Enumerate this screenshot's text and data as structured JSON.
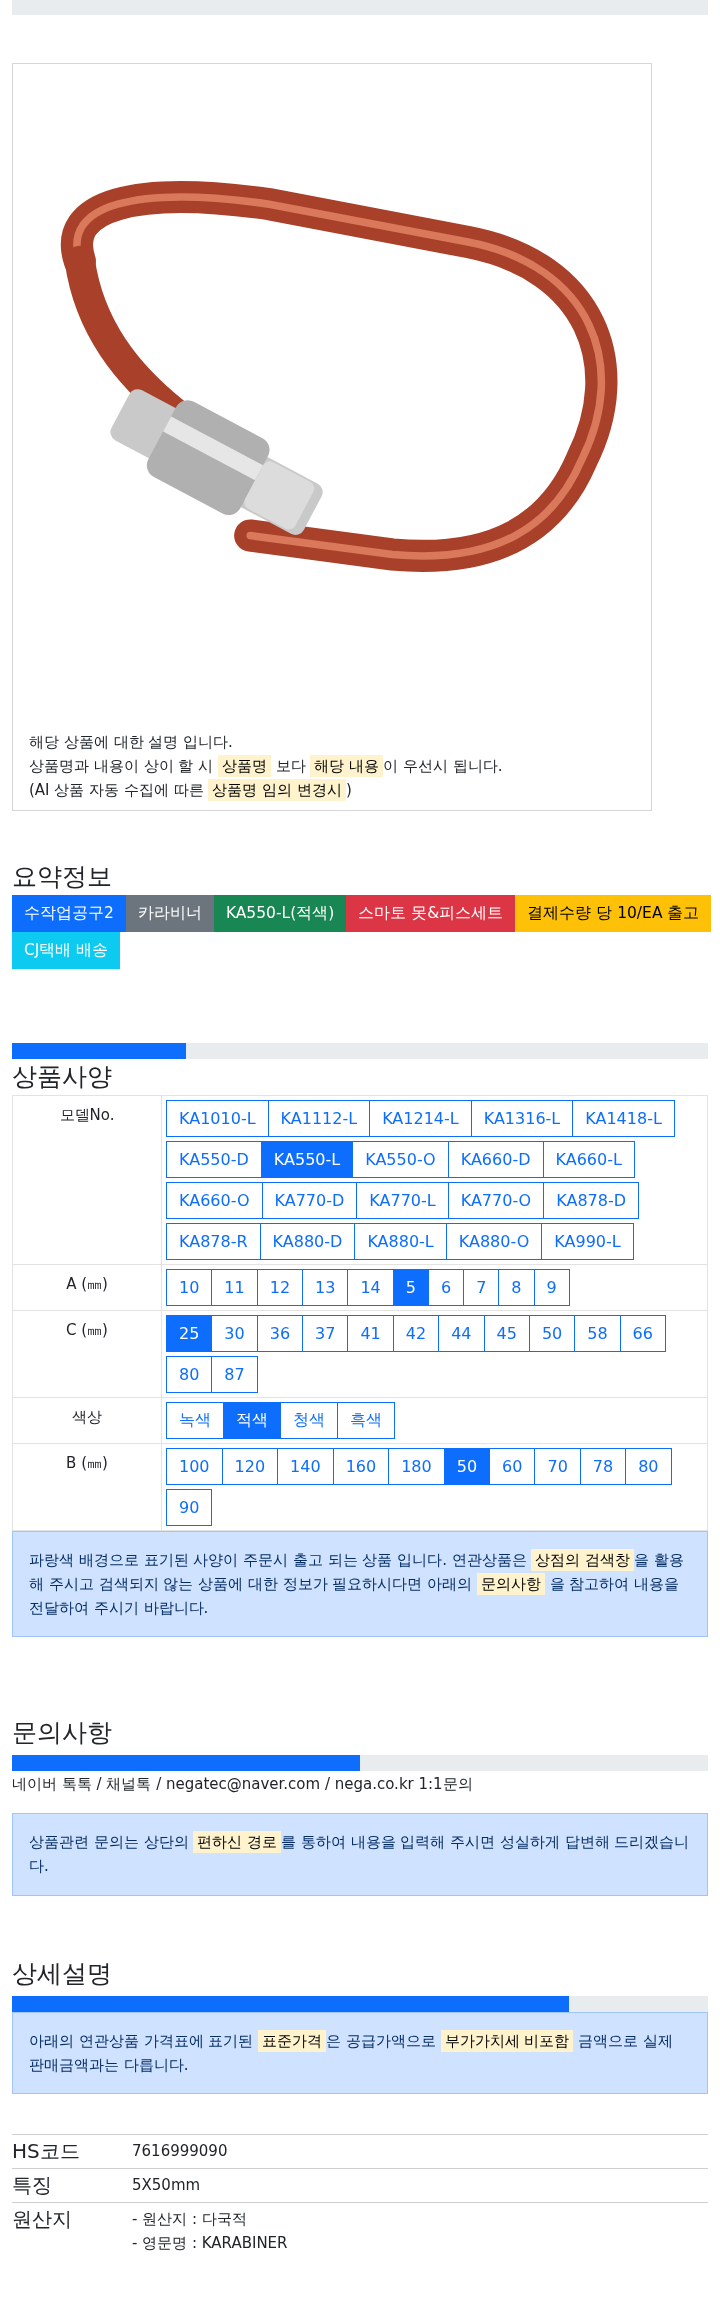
{
  "top_progress": {
    "level": 0
  },
  "description": {
    "lines": [
      [
        {
          "text": "해당 상품에 대한 설명 입니다.",
          "highlight": false
        }
      ],
      [
        {
          "text": "상품명과 내용이 상이 할 시 ",
          "highlight": false
        },
        {
          "text": "상품명",
          "highlight": true
        },
        {
          "text": " 보다 ",
          "highlight": false
        },
        {
          "text": "해당 내용",
          "highlight": true
        },
        {
          "text": "이 우선시 됩니다.",
          "highlight": false
        }
      ],
      [
        {
          "text": "(AI 상품 자동 수집에 따른 ",
          "highlight": false
        },
        {
          "text": "상품명 임의 변경시",
          "highlight": true
        },
        {
          "text": ")",
          "highlight": false
        }
      ]
    ]
  },
  "summary": {
    "title": "요약정보",
    "tags": [
      {
        "label": "수작업공구2",
        "color": "#0d6efd"
      },
      {
        "label": "카라비너",
        "color": "#6c757d"
      },
      {
        "label": "KA550-L(적색)",
        "color": "#198754"
      },
      {
        "label": "스마토 못&피스세트",
        "color": "#dc3545"
      },
      {
        "label": "결제수량 당 10/EA 출고",
        "color": "#ffc107"
      },
      {
        "label": "CJ택배 배송",
        "color": "#0dcaf0"
      }
    ]
  },
  "specs": {
    "progress": {
      "level": 0.25
    },
    "title": "상품사양",
    "rows": [
      {
        "label": "모델No.",
        "options": [
          {
            "label": "KA1010-L",
            "selected": false
          },
          {
            "label": "KA1112-L",
            "selected": false
          },
          {
            "label": "KA1214-L",
            "selected": false
          },
          {
            "label": "KA1316-L",
            "selected": false
          },
          {
            "label": "KA1418-L",
            "selected": false
          },
          {
            "label": "KA550-D",
            "selected": false
          },
          {
            "label": "KA550-L",
            "selected": true
          },
          {
            "label": "KA550-O",
            "selected": false
          },
          {
            "label": "KA660-D",
            "selected": false
          },
          {
            "label": "KA660-L",
            "selected": false
          },
          {
            "label": "KA660-O",
            "selected": false
          },
          {
            "label": "KA770-D",
            "selected": false
          },
          {
            "label": "KA770-L",
            "selected": false
          },
          {
            "label": "KA770-O",
            "selected": false
          },
          {
            "label": "KA878-D",
            "selected": false
          },
          {
            "label": "KA878-R",
            "selected": false
          },
          {
            "label": "KA880-D",
            "selected": false
          },
          {
            "label": "KA880-L",
            "selected": false
          },
          {
            "label": "KA880-O",
            "selected": false
          },
          {
            "label": "KA990-L",
            "selected": false
          }
        ]
      },
      {
        "label": "A (㎜)",
        "options": [
          {
            "label": "10",
            "selected": false
          },
          {
            "label": "11",
            "selected": false
          },
          {
            "label": "12",
            "selected": false
          },
          {
            "label": "13",
            "selected": false
          },
          {
            "label": "14",
            "selected": false
          },
          {
            "label": "5",
            "selected": true
          },
          {
            "label": "6",
            "selected": false
          },
          {
            "label": "7",
            "selected": false
          },
          {
            "label": "8",
            "selected": false
          },
          {
            "label": "9",
            "selected": false
          }
        ]
      },
      {
        "label": "C (㎜)",
        "options": [
          {
            "label": "25",
            "selected": true
          },
          {
            "label": "30",
            "selected": false
          },
          {
            "label": "36",
            "selected": false
          },
          {
            "label": "37",
            "selected": false
          },
          {
            "label": "41",
            "selected": false
          },
          {
            "label": "42",
            "selected": false
          },
          {
            "label": "44",
            "selected": false
          },
          {
            "label": "45",
            "selected": false
          },
          {
            "label": "50",
            "selected": false
          },
          {
            "label": "58",
            "selected": false
          },
          {
            "label": "66",
            "selected": false
          },
          {
            "label": "80",
            "selected": false
          },
          {
            "label": "87",
            "selected": false
          }
        ]
      },
      {
        "label": "색상",
        "options": [
          {
            "label": "녹색",
            "selected": false
          },
          {
            "label": "적색",
            "selected": true
          },
          {
            "label": "청색",
            "selected": false
          },
          {
            "label": "흑색",
            "selected": false
          }
        ]
      },
      {
        "label": "B (㎜)",
        "options": [
          {
            "label": "100",
            "selected": false
          },
          {
            "label": "120",
            "selected": false
          },
          {
            "label": "140",
            "selected": false
          },
          {
            "label": "160",
            "selected": false
          },
          {
            "label": "180",
            "selected": false
          },
          {
            "label": "50",
            "selected": true
          },
          {
            "label": "60",
            "selected": false
          },
          {
            "label": "70",
            "selected": false
          },
          {
            "label": "78",
            "selected": false
          },
          {
            "label": "80",
            "selected": false
          },
          {
            "label": "90",
            "selected": false
          }
        ]
      }
    ],
    "notice": [
      {
        "text": "파랑색 배경으로 표기된 사양이 주문시 출고 되는 상품 입니다. 연관상품은 ",
        "highlight": false
      },
      {
        "text": "상점의 검색창",
        "highlight": true
      },
      {
        "text": "을 활용해 주시고 검색되지 않는 상품에 대한 정보가 필요하시다면 아래의 ",
        "highlight": false
      },
      {
        "text": "문의사항",
        "highlight": true
      },
      {
        "text": " 을 참고하여 내용을 전달하여 주시기 바랍니다.",
        "highlight": false
      }
    ]
  },
  "inquiry": {
    "title": "문의사항",
    "progress": {
      "level": 0.5
    },
    "contacts": "네이버 톡톡  /  채널톡  /  negatec@naver.com  /  nega.co.kr 1:1문의",
    "notice": [
      {
        "text": "상품관련 문의는 상단의 ",
        "highlight": false
      },
      {
        "text": "편하신 경로",
        "highlight": true
      },
      {
        "text": "를 통하여 내용을 입력해 주시면 성실하게 답변해 드리겠습니다.",
        "highlight": false
      }
    ]
  },
  "details": {
    "title": "상세설명",
    "progress": {
      "level": 0.8
    },
    "notice": [
      {
        "text": "아래의 연관상품 가격표에 표기된 ",
        "highlight": false
      },
      {
        "text": "표준가격",
        "highlight": true
      },
      {
        "text": "은 공급가액으로 ",
        "highlight": false
      },
      {
        "text": "부가가치세 비포함",
        "highlight": true
      },
      {
        "text": " 금액으로 실제 판매금액과는 다릅니다.",
        "highlight": false
      }
    ],
    "rows": [
      {
        "label": "HS코드",
        "values": [
          "7616999090"
        ]
      },
      {
        "label": "특징",
        "values": [
          "5X50mm"
        ]
      },
      {
        "label": "원산지",
        "values": [
          "- 원산지 : 다국적",
          "- 영문명 : KARABINER"
        ]
      }
    ]
  }
}
